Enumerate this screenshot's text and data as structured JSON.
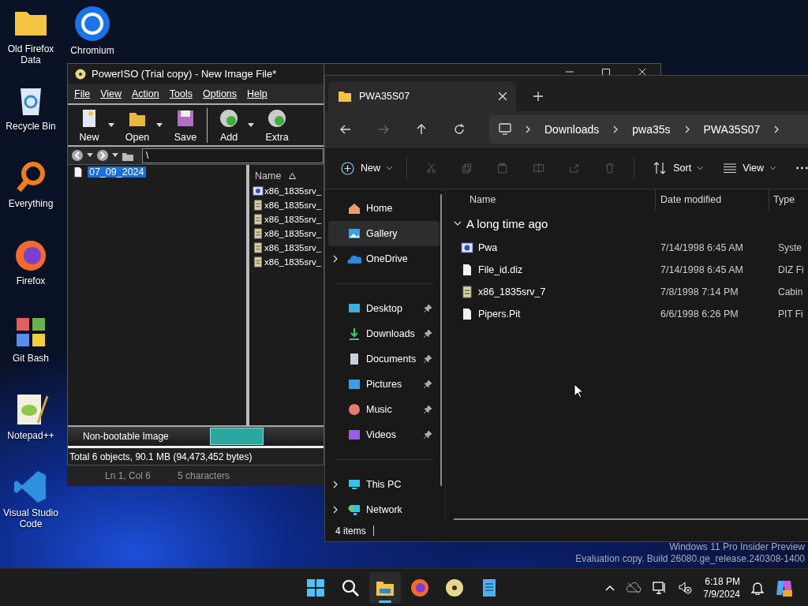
{
  "desktop_icons": [
    {
      "label": "Old Firefox Data"
    },
    {
      "label": "Recycle Bin"
    },
    {
      "label": "Everything"
    },
    {
      "label": "Firefox"
    },
    {
      "label": "Git Bash"
    },
    {
      "label": "Notepad++"
    },
    {
      "label": "Visual Studio Code"
    },
    {
      "label": "Chromium"
    }
  ],
  "poweriso": {
    "title": "PowerISO (Trial copy) - New Image File*",
    "menu": [
      "File",
      "View",
      "Action",
      "Tools",
      "Options",
      "Help"
    ],
    "toolbar": [
      {
        "label": "New",
        "dropdown": true
      },
      {
        "label": "Open",
        "dropdown": true
      },
      {
        "label": "Save",
        "dropdown": false
      },
      {
        "label": "Add",
        "dropdown": true
      },
      {
        "label": "Extra",
        "dropdown": false
      }
    ],
    "path": "\\",
    "tree": [
      {
        "label": "07_09_2024",
        "selected": true
      }
    ],
    "list_column": "Name",
    "list_rows": [
      {
        "name": "x86_1835srv_",
        "kind": "app"
      },
      {
        "name": "x86_1835srv_",
        "kind": "cabinet"
      },
      {
        "name": "x86_1835srv_",
        "kind": "cabinet"
      },
      {
        "name": "x86_1835srv_",
        "kind": "cabinet"
      },
      {
        "name": "x86_1835srv_",
        "kind": "cabinet"
      },
      {
        "name": "x86_1835srv_",
        "kind": "cabinet"
      }
    ],
    "image_type": "Non-bootable Image",
    "status": "Total 6 objects, 90.1 MB (94,473,452 bytes)"
  },
  "notepad_status": [
    "Ln 1, Col 6",
    "5 characters"
  ],
  "explorer": {
    "tab": "PWA35S07",
    "breadcrumb": [
      "Downloads",
      "pwa35s",
      "PWA35S07"
    ],
    "commands": [
      {
        "label": "New"
      },
      {
        "label": "Sort"
      },
      {
        "label": "View"
      }
    ],
    "nav": [
      {
        "label": "Home",
        "kind": "plain",
        "selected": false
      },
      {
        "label": "Gallery",
        "kind": "plain",
        "selected": true
      },
      {
        "label": "OneDrive",
        "kind": "node",
        "selected": false
      },
      {
        "label": "Desktop",
        "kind": "pinned",
        "selected": false
      },
      {
        "label": "Downloads",
        "kind": "pinned",
        "selected": false
      },
      {
        "label": "Documents",
        "kind": "pinned",
        "selected": false
      },
      {
        "label": "Pictures",
        "kind": "pinned",
        "selected": false
      },
      {
        "label": "Music",
        "kind": "pinned",
        "selected": false
      },
      {
        "label": "Videos",
        "kind": "pinned",
        "selected": false
      },
      {
        "label": "This PC",
        "kind": "node",
        "selected": false
      },
      {
        "label": "Network",
        "kind": "node",
        "selected": false
      }
    ],
    "columns": [
      "Name",
      "Date modified",
      "Type"
    ],
    "group": {
      "label": "A long time ago",
      "expanded": true
    },
    "rows": [
      {
        "name": "Pwa",
        "date": "7/14/1998 6:45 AM",
        "type": "Syste",
        "kind": "app"
      },
      {
        "name": "File_id.diz",
        "date": "7/14/1998 6:45 AM",
        "type": "DIZ Fi",
        "kind": "file"
      },
      {
        "name": "x86_1835srv_7",
        "date": "7/8/1998 7:14 PM",
        "type": "Cabin",
        "kind": "cabinet"
      },
      {
        "name": "Pipers.Pit",
        "date": "6/6/1998 6:26 PM",
        "type": "PIT Fi",
        "kind": "file"
      }
    ],
    "status": "4 items"
  },
  "os_notice": [
    "Windows 11 Pro Insider Preview",
    "Evaluation copy. Build 26080.ge_release.240308-1400"
  ],
  "taskbar": {
    "apps": [
      {
        "active": false
      },
      {
        "active": false
      },
      {
        "active": true
      },
      {
        "active": false
      },
      {
        "active": false
      },
      {
        "active": false
      }
    ],
    "time": "6:18 PM",
    "date": "7/9/2024"
  }
}
